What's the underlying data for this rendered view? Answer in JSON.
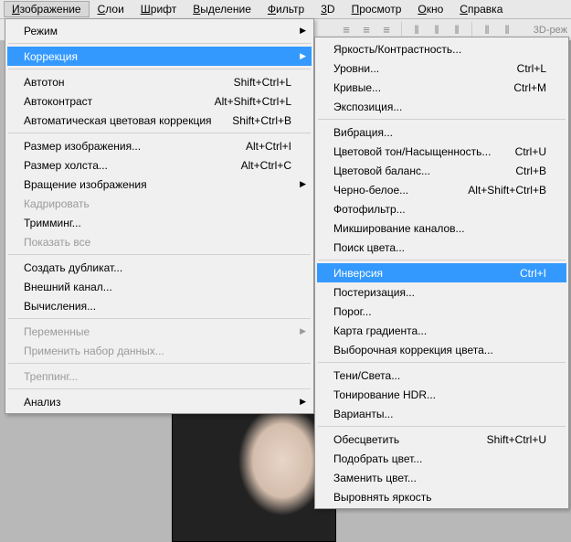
{
  "menubar": {
    "items": [
      {
        "label": "Изображение",
        "open": true
      },
      {
        "label": "Слои"
      },
      {
        "label": "Шрифт"
      },
      {
        "label": "Выделение"
      },
      {
        "label": "Фильтр"
      },
      {
        "label": "3D"
      },
      {
        "label": "Просмотр"
      },
      {
        "label": "Окно"
      },
      {
        "label": "Справка"
      }
    ]
  },
  "toolbar": {
    "mode_label": "3D-реж"
  },
  "menu1": [
    {
      "label": "Режим",
      "sub": true
    },
    {
      "sep": true
    },
    {
      "label": "Коррекция",
      "sub": true,
      "highlight": true
    },
    {
      "sep": true
    },
    {
      "label": "Автотон",
      "shortcut": "Shift+Ctrl+L"
    },
    {
      "label": "Автоконтраст",
      "shortcut": "Alt+Shift+Ctrl+L"
    },
    {
      "label": "Автоматическая цветовая коррекция",
      "shortcut": "Shift+Ctrl+B"
    },
    {
      "sep": true
    },
    {
      "label": "Размер изображения...",
      "shortcut": "Alt+Ctrl+I"
    },
    {
      "label": "Размер холста...",
      "shortcut": "Alt+Ctrl+C"
    },
    {
      "label": "Вращение изображения",
      "sub": true
    },
    {
      "label": "Кадрировать",
      "disabled": true
    },
    {
      "label": "Тримминг..."
    },
    {
      "label": "Показать все",
      "disabled": true
    },
    {
      "sep": true
    },
    {
      "label": "Создать дубликат..."
    },
    {
      "label": "Внешний канал..."
    },
    {
      "label": "Вычисления..."
    },
    {
      "sep": true
    },
    {
      "label": "Переменные",
      "sub": true,
      "disabled": true
    },
    {
      "label": "Применить набор данных...",
      "disabled": true
    },
    {
      "sep": true
    },
    {
      "label": "Треппинг...",
      "disabled": true
    },
    {
      "sep": true
    },
    {
      "label": "Анализ",
      "sub": true
    }
  ],
  "menu2": [
    {
      "label": "Яркость/Контрастность..."
    },
    {
      "label": "Уровни...",
      "shortcut": "Ctrl+L"
    },
    {
      "label": "Кривые...",
      "shortcut": "Ctrl+M"
    },
    {
      "label": "Экспозиция..."
    },
    {
      "sep": true
    },
    {
      "label": "Вибрация..."
    },
    {
      "label": "Цветовой тон/Насыщенность...",
      "shortcut": "Ctrl+U"
    },
    {
      "label": "Цветовой баланс...",
      "shortcut": "Ctrl+B"
    },
    {
      "label": "Черно-белое...",
      "shortcut": "Alt+Shift+Ctrl+B"
    },
    {
      "label": "Фотофильтр..."
    },
    {
      "label": "Микширование каналов..."
    },
    {
      "label": "Поиск цвета..."
    },
    {
      "sep": true
    },
    {
      "label": "Инверсия",
      "shortcut": "Ctrl+I",
      "highlight": true
    },
    {
      "label": "Постеризация..."
    },
    {
      "label": "Порог..."
    },
    {
      "label": "Карта градиента..."
    },
    {
      "label": "Выборочная коррекция цвета..."
    },
    {
      "sep": true
    },
    {
      "label": "Тени/Света..."
    },
    {
      "label": "Тонирование HDR..."
    },
    {
      "label": "Варианты..."
    },
    {
      "sep": true
    },
    {
      "label": "Обесцветить",
      "shortcut": "Shift+Ctrl+U"
    },
    {
      "label": "Подобрать цвет..."
    },
    {
      "label": "Заменить цвет..."
    },
    {
      "label": "Выровнять яркость"
    }
  ]
}
